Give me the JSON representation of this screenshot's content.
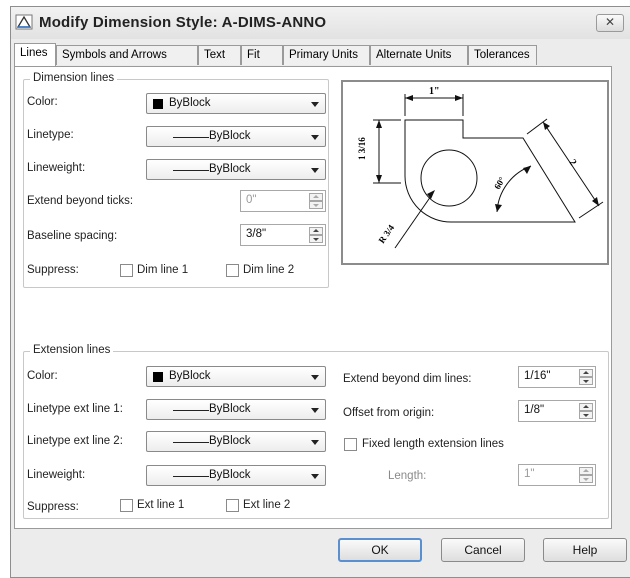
{
  "window": {
    "title": "Modify Dimension Style: A-DIMS-ANNO",
    "close_label": "✕"
  },
  "tabs": [
    {
      "label": "Lines"
    },
    {
      "label": "Symbols and Arrows"
    },
    {
      "label": "Text"
    },
    {
      "label": "Fit"
    },
    {
      "label": "Primary Units"
    },
    {
      "label": "Alternate Units"
    },
    {
      "label": "Tolerances"
    }
  ],
  "dimension_lines": {
    "title": "Dimension lines",
    "color": {
      "label": "Color:",
      "value": "ByBlock"
    },
    "linetype": {
      "label": "Linetype:",
      "value": "ByBlock"
    },
    "lineweight": {
      "label": "Lineweight:",
      "value": "ByBlock"
    },
    "extend_beyond_ticks": {
      "label": "Extend beyond ticks:",
      "value": "0\""
    },
    "baseline_spacing": {
      "label": "Baseline spacing:",
      "value": "3/8\""
    },
    "suppress": {
      "label": "Suppress:",
      "dim_line_1": "Dim line 1",
      "dim_line_2": "Dim line 2"
    }
  },
  "extension_lines": {
    "title": "Extension lines",
    "color": {
      "label": "Color:",
      "value": "ByBlock"
    },
    "linetype_ext_line_1": {
      "label": "Linetype ext line 1:",
      "value": "ByBlock"
    },
    "linetype_ext_line_2": {
      "label": "Linetype ext line 2:",
      "value": "ByBlock"
    },
    "lineweight": {
      "label": "Lineweight:",
      "value": "ByBlock"
    },
    "suppress": {
      "label": "Suppress:",
      "ext_line_1": "Ext line 1",
      "ext_line_2": "Ext line 2"
    },
    "extend_beyond_dim_lines": {
      "label": "Extend beyond dim lines:",
      "value": "1/16\""
    },
    "offset_from_origin": {
      "label": "Offset from origin:",
      "value": "1/8\""
    },
    "fixed_length": {
      "label": "Fixed length extension lines",
      "checked": false
    },
    "length": {
      "label": "Length:",
      "value": "1\""
    }
  },
  "preview": {
    "dim_top": "1\"",
    "dim_left": "1 3/16",
    "dim_right": "2",
    "dim_angle": "60°",
    "dim_radius": "R 3/4"
  },
  "buttons": {
    "ok": "OK",
    "cancel": "Cancel",
    "help": "Help"
  }
}
